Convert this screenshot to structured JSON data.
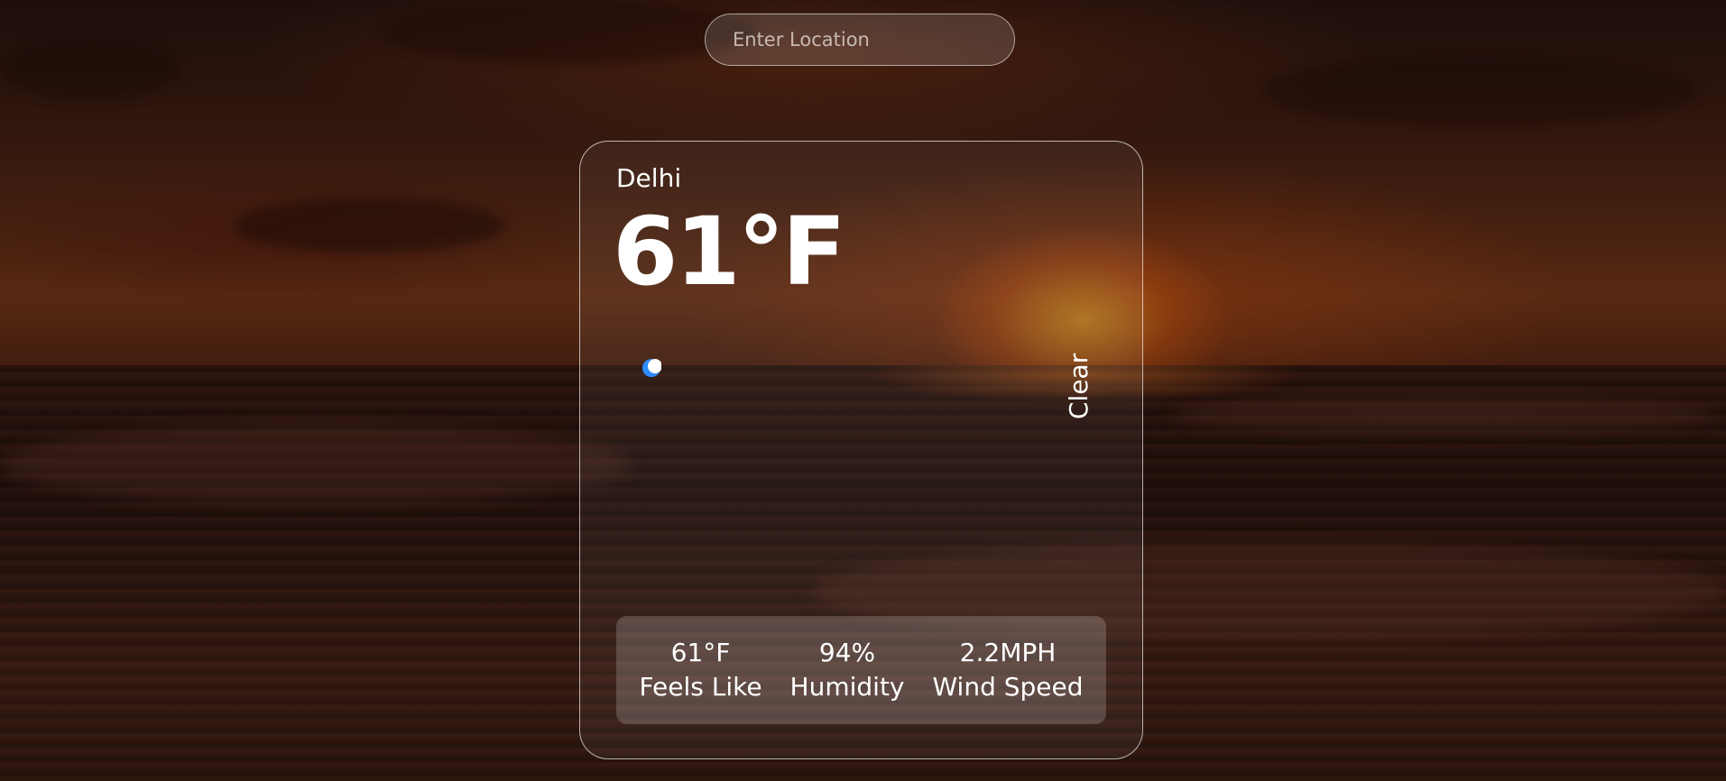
{
  "search": {
    "placeholder": "Enter Location",
    "value": ""
  },
  "weather": {
    "city": "Delhi",
    "temperature": "61°F",
    "condition": "Clear",
    "icon": "moon-icon"
  },
  "stats": [
    {
      "value": "61°F",
      "label": "Feels Like"
    },
    {
      "value": "94%",
      "label": "Humidity"
    },
    {
      "value": "2.2MPH",
      "label": "Wind Speed"
    }
  ],
  "colors": {
    "text": "#ffffff",
    "icon_accent": "#2d8cff"
  }
}
